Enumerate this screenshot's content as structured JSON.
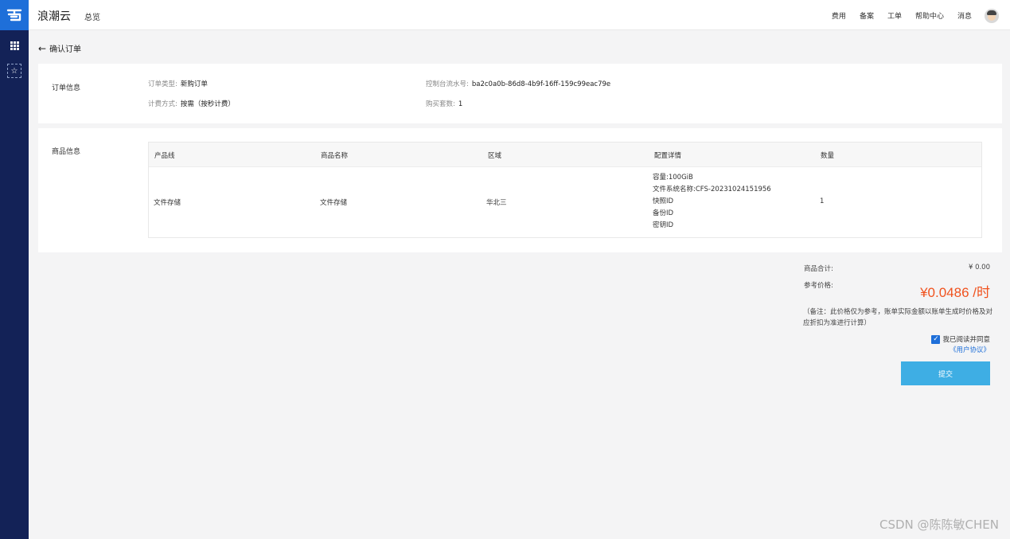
{
  "app": {
    "brand": "浪潮云",
    "overview": "总览",
    "top_nav": [
      "费用",
      "备案",
      "工单",
      "帮助中心",
      "消息"
    ]
  },
  "page": {
    "title": "确认订单"
  },
  "order_info": {
    "label": "订单信息",
    "order_type_key": "订单类型:",
    "order_type_value": "新购订单",
    "billing_key": "计费方式:",
    "billing_value": "按需（按秒计费）",
    "serial_key": "控制台流水号:",
    "serial_value": "ba2c0a0b-86d8-4b9f-16ff-159c99eac79e",
    "count_key": "购买套数:",
    "count_value": "1"
  },
  "product_info": {
    "label": "商品信息",
    "columns": [
      "产品线",
      "商品名称",
      "区域",
      "配置详情",
      "数量"
    ],
    "row": {
      "product_line": "文件存储",
      "product_name": "文件存储",
      "region": "华北三",
      "details": [
        "容量:100GiB",
        "文件系统名称:CFS-20231024151956",
        "快照ID",
        "备份ID",
        "密钥ID"
      ],
      "quantity": "1"
    }
  },
  "summary": {
    "total_label": "商品合计:",
    "total_value": "¥ 0.00",
    "ref_label": "参考价格:",
    "ref_price": "¥0.0486 /时",
    "remark": "（备注：此价格仅为参考，账单实际金额以账单生成时价格及对应折扣为准进行计算）",
    "agree_text": "我已阅读并同意",
    "agreement_link": "《用户协议》",
    "submit": "提交"
  },
  "watermark": "CSDN @陈陈敏CHEN",
  "colors": {
    "sidebar": "#132257",
    "accent": "#1e6fd9",
    "price": "#f0521e",
    "submit": "#3eaee4"
  }
}
